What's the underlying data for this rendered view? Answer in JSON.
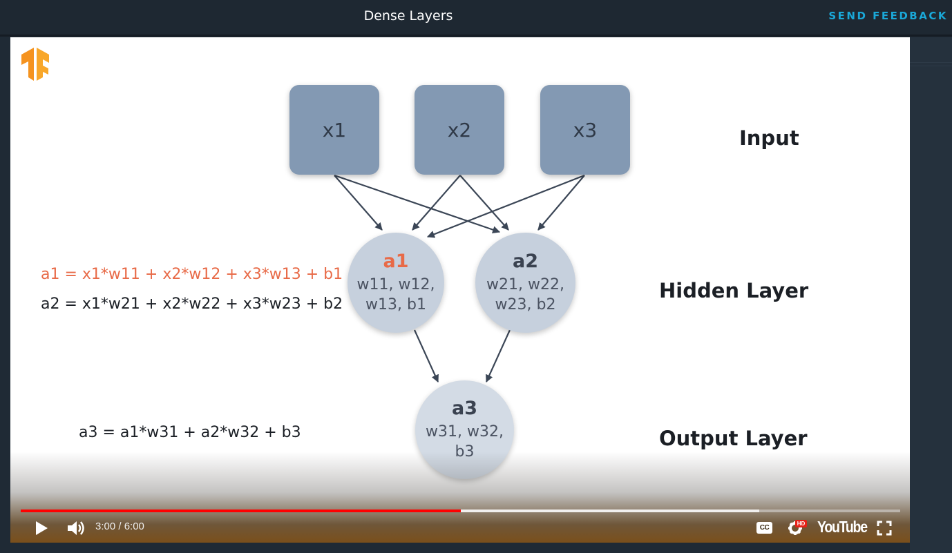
{
  "header": {
    "title": "Dense Layers",
    "feedback_label": "SEND FEEDBACK"
  },
  "slide": {
    "inputs": [
      "x1",
      "x2",
      "x3"
    ],
    "hidden": [
      {
        "name": "a1",
        "weights_line1": "w11, w12,",
        "weights_line2": "w13, b1"
      },
      {
        "name": "a2",
        "weights_line1": "w21, w22,",
        "weights_line2": "w23, b2"
      }
    ],
    "output": {
      "name": "a3",
      "weights_line1": "w31, w32,",
      "weights_line2": "b3"
    },
    "labels": {
      "input": "Input",
      "hidden": "Hidden Layer",
      "output": "Output Layer"
    },
    "equations": {
      "a1": "a1 = x1*w11 + x2*w12 + x3*w13 + b1",
      "a2": "a2 = x1*w21 + x2*w22 + x3*w23 + b2",
      "a3": "a3 = a1*w31 + a2*w32 + b3"
    },
    "colors": {
      "highlight": "#e86a47",
      "node_box": "#8399b3",
      "node_circle": "#c6d0dd",
      "arrow": "#3b4656",
      "tf_logo": "#f5931f"
    }
  },
  "player": {
    "time_display": "3:00 / 6:00",
    "played_fraction": 0.5,
    "buffered_fraction": 0.84,
    "hd_badge": "HD",
    "cc_label": "CC",
    "brand": "YouTube",
    "colors": {
      "progress": "#ff0000"
    }
  }
}
